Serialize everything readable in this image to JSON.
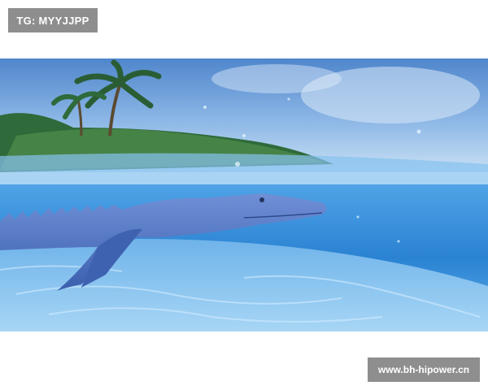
{
  "watermark_top_left": "TG: MYYJJPP",
  "watermark_bottom_right": "www.bh-hipower.cn",
  "image": {
    "subject": "crocodile-icon",
    "colors": {
      "sky_top": "#5b8fd0",
      "sky_bottom": "#b9d6f0",
      "water": "#2e86d4",
      "sand": "#8fc6ee",
      "croc": "#4f75bf",
      "palm": "#2f6a3a"
    }
  }
}
